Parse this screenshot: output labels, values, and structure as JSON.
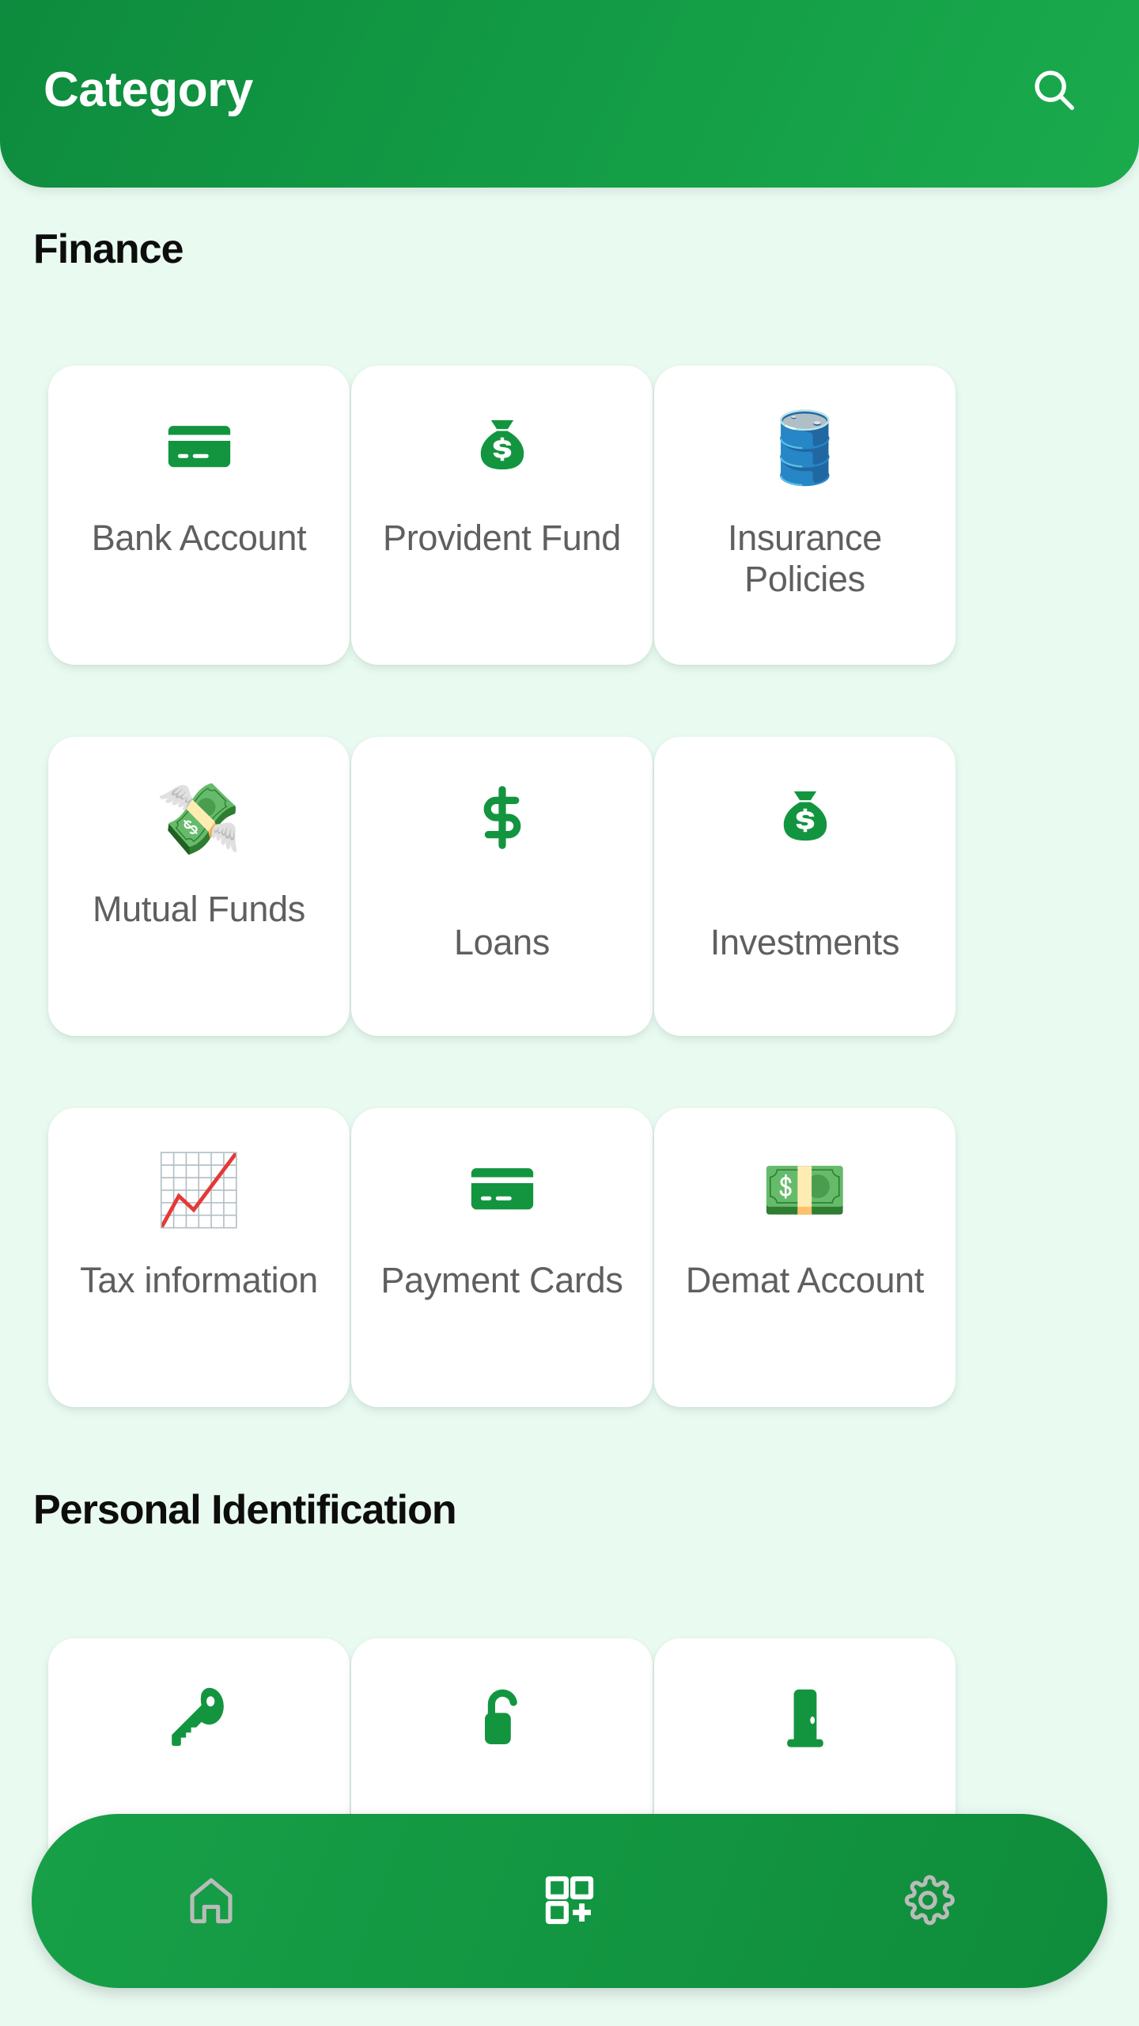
{
  "header": {
    "title": "Category",
    "search_icon": "search-icon",
    "background_color": "#129a44",
    "title_color": "#ffffff"
  },
  "theme": {
    "page_background": "#e9faf1",
    "card_background": "#ffffff",
    "accent_green": "#13953f",
    "label_color": "#5f5f5f",
    "section_title_color": "#0d0d0d",
    "insurance_blue": "#2980c4"
  },
  "sections": [
    {
      "title": "Finance",
      "items": [
        {
          "label": "Bank Account",
          "icon": "credit-card-icon",
          "icon_type": "svg",
          "glyph": ""
        },
        {
          "label": "Provident Fund",
          "icon": "money-bag-icon",
          "icon_type": "svg",
          "glyph": ""
        },
        {
          "label": "Insurance Policies",
          "icon": "oil-drum-icon",
          "icon_type": "emoji",
          "glyph": "🛢️"
        },
        {
          "label": "Mutual Funds",
          "icon": "money-with-wings-icon",
          "icon_type": "emoji",
          "glyph": "💸"
        },
        {
          "label": "Loans",
          "icon": "dollar-sign-icon",
          "icon_type": "svg",
          "glyph": ""
        },
        {
          "label": "Investments",
          "icon": "money-bag-icon",
          "icon_type": "svg",
          "glyph": ""
        },
        {
          "label": "Tax information",
          "icon": "chart-increasing-icon",
          "icon_type": "emoji",
          "glyph": "📈"
        },
        {
          "label": "Payment Cards",
          "icon": "credit-card-icon",
          "icon_type": "svg",
          "glyph": ""
        },
        {
          "label": "Demat Account",
          "icon": "dollar-banknote-icon",
          "icon_type": "emoji",
          "glyph": "💵"
        }
      ]
    },
    {
      "title": "Personal Identification",
      "items": [
        {
          "label": "",
          "icon": "key-icon",
          "icon_type": "svg",
          "glyph": ""
        },
        {
          "label": "",
          "icon": "unlocked-padlock-icon",
          "icon_type": "svg",
          "glyph": ""
        },
        {
          "label": "",
          "icon": "door-icon",
          "icon_type": "svg",
          "glyph": ""
        }
      ]
    }
  ],
  "bottom_nav": {
    "items": [
      {
        "name": "home",
        "icon": "home-icon",
        "active": false
      },
      {
        "name": "categories",
        "icon": "dashboard-add-icon",
        "active": true
      },
      {
        "name": "settings",
        "icon": "gear-icon",
        "active": false
      }
    ],
    "active_color": "#ffffff",
    "inactive_color": "#b9bcb9"
  }
}
